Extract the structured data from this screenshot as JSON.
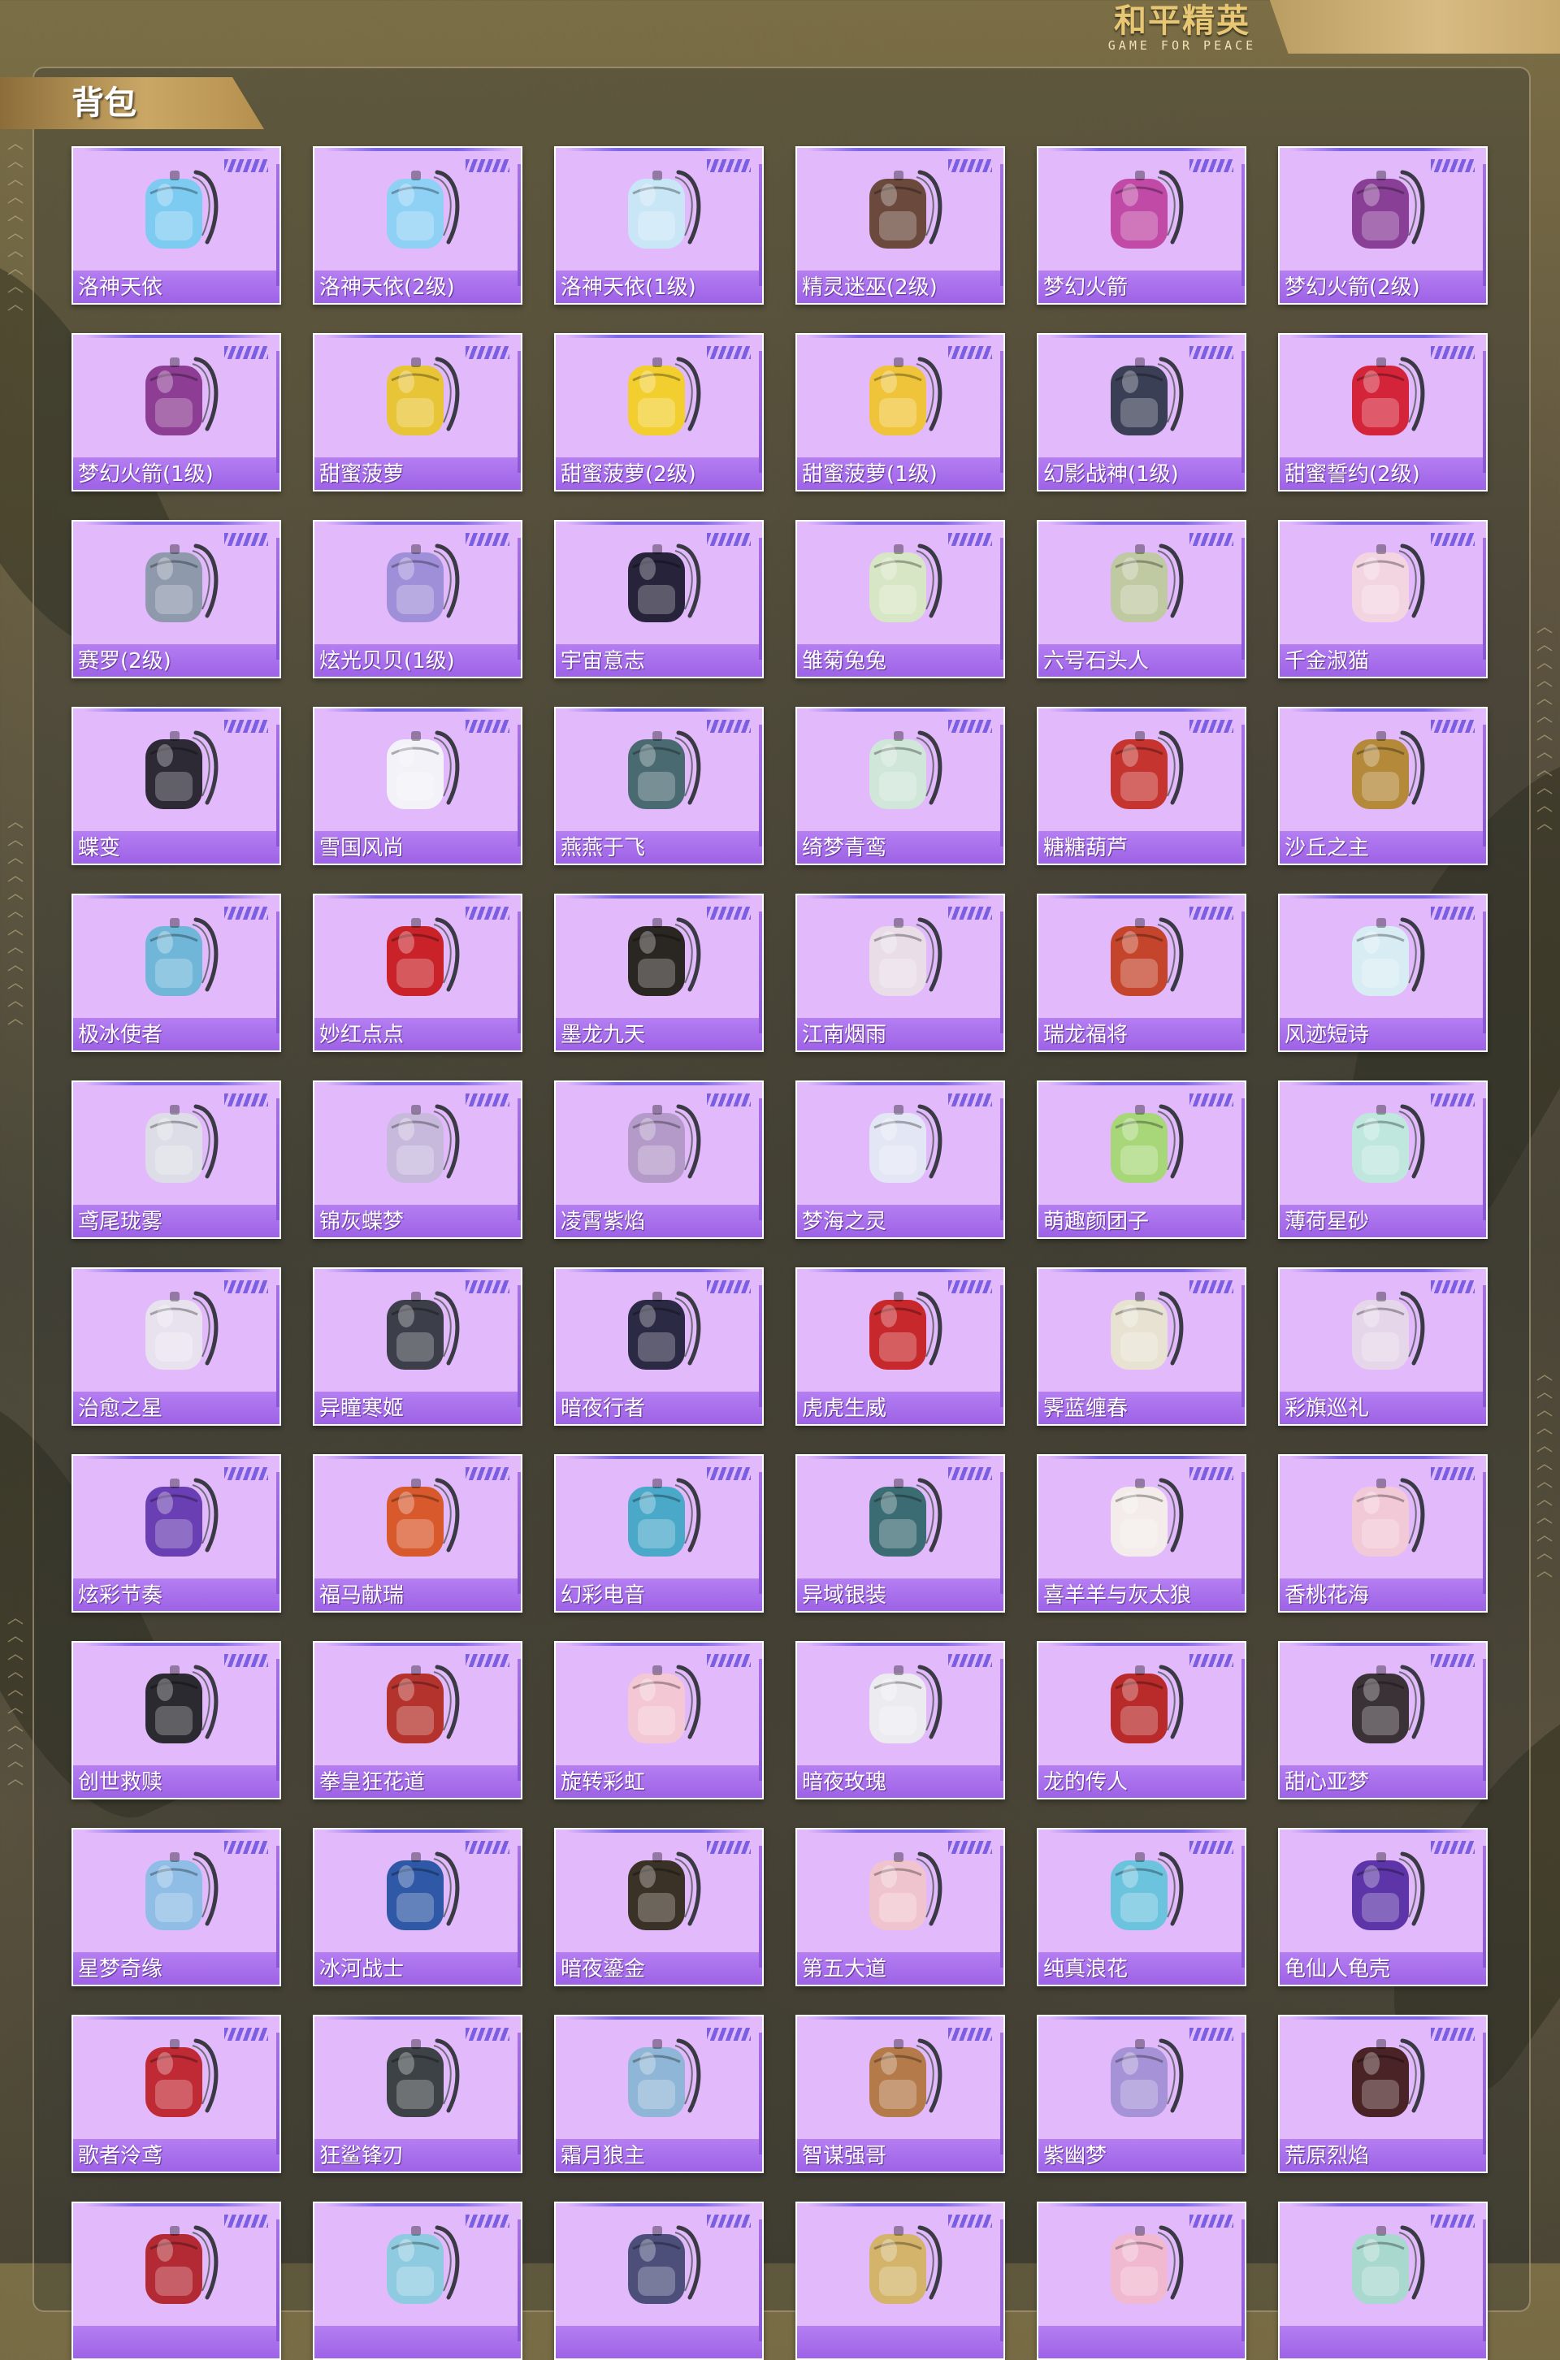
{
  "logo": {
    "main": "和平精英",
    "sub": "GAME FOR PEACE"
  },
  "section": {
    "title": "背包"
  },
  "items": [
    {
      "name": "洛神天依",
      "icon": "backpack-icon",
      "color": "#7ecbf2"
    },
    {
      "name": "洛神天依(2级)",
      "icon": "backpack-icon",
      "color": "#8fd0f5"
    },
    {
      "name": "洛神天依(1级)",
      "icon": "backpack-icon",
      "color": "#c9e6f7"
    },
    {
      "name": "精灵迷巫(2级)",
      "icon": "backpack-icon",
      "color": "#6b4a3d"
    },
    {
      "name": "梦幻火箭",
      "icon": "backpack-icon",
      "color": "#c04aa6"
    },
    {
      "name": "梦幻火箭(2级)",
      "icon": "backpack-icon",
      "color": "#8a3f97"
    },
    {
      "name": "梦幻火箭(1级)",
      "icon": "backpack-icon",
      "color": "#8d3d93"
    },
    {
      "name": "甜蜜菠萝",
      "icon": "backpack-icon",
      "color": "#e8c537"
    },
    {
      "name": "甜蜜菠萝(2级)",
      "icon": "backpack-icon",
      "color": "#f2cf2f"
    },
    {
      "name": "甜蜜菠萝(1级)",
      "icon": "backpack-icon",
      "color": "#f0c43a"
    },
    {
      "name": "幻影战神(1级)",
      "icon": "backpack-icon",
      "color": "#3b3f56"
    },
    {
      "name": "甜蜜誓约(2级)",
      "icon": "backpack-icon",
      "color": "#d4243a"
    },
    {
      "name": "赛罗(2级)",
      "icon": "backpack-icon",
      "color": "#8e99ac"
    },
    {
      "name": "炫光贝贝(1级)",
      "icon": "backpack-icon",
      "color": "#9f8fd9"
    },
    {
      "name": "宇宙意志",
      "icon": "backpack-icon",
      "color": "#26233a"
    },
    {
      "name": "雏菊兔兔",
      "icon": "backpack-icon",
      "color": "#d7e6c4"
    },
    {
      "name": "六号石头人",
      "icon": "backpack-icon",
      "color": "#bfc9a2"
    },
    {
      "name": "千金淑猫",
      "icon": "backpack-icon",
      "color": "#f3d5e2"
    },
    {
      "name": "蝶变",
      "icon": "backpack-icon",
      "color": "#2d2a35"
    },
    {
      "name": "雪国风尚",
      "icon": "backpack-icon",
      "color": "#f2f2f8"
    },
    {
      "name": "燕燕于飞",
      "icon": "backpack-icon",
      "color": "#4a6a72"
    },
    {
      "name": "绮梦青鸾",
      "icon": "backpack-icon",
      "color": "#cfe6d9"
    },
    {
      "name": "糖糖葫芦",
      "icon": "backpack-icon",
      "color": "#c6342f"
    },
    {
      "name": "沙丘之主",
      "icon": "backpack-icon",
      "color": "#b5893a"
    },
    {
      "name": "极冰使者",
      "icon": "backpack-icon",
      "color": "#6fb6d8"
    },
    {
      "name": "妙红点点",
      "icon": "backpack-icon",
      "color": "#c92229"
    },
    {
      "name": "墨龙九天",
      "icon": "backpack-icon",
      "color": "#2a2622"
    },
    {
      "name": "江南烟雨",
      "icon": "backpack-icon",
      "color": "#e9dde8"
    },
    {
      "name": "瑞龙福将",
      "icon": "backpack-icon",
      "color": "#c5452c"
    },
    {
      "name": "风迹短诗",
      "icon": "backpack-icon",
      "color": "#d7ecf3"
    },
    {
      "name": "鸢尾珑雾",
      "icon": "backpack-icon",
      "color": "#dcdde6"
    },
    {
      "name": "锦灰蝶梦",
      "icon": "backpack-icon",
      "color": "#c7b9dc"
    },
    {
      "name": "凌霄紫焰",
      "icon": "backpack-icon",
      "color": "#b49ac9"
    },
    {
      "name": "梦海之灵",
      "icon": "backpack-icon",
      "color": "#e3e6f4"
    },
    {
      "name": "萌趣颜团子",
      "icon": "backpack-icon",
      "color": "#a8d77a"
    },
    {
      "name": "薄荷星砂",
      "icon": "backpack-icon",
      "color": "#bfe7de"
    },
    {
      "name": "治愈之星",
      "icon": "backpack-icon",
      "color": "#e8e2ef"
    },
    {
      "name": "异瞳寒姬",
      "icon": "backpack-icon",
      "color": "#3c3f4a"
    },
    {
      "name": "暗夜行者",
      "icon": "backpack-icon",
      "color": "#2b2a45"
    },
    {
      "name": "虎虎生威",
      "icon": "backpack-icon",
      "color": "#c7282b"
    },
    {
      "name": "霁蓝缠春",
      "icon": "backpack-icon",
      "color": "#e7e2d2"
    },
    {
      "name": "彩旗巡礼",
      "icon": "backpack-icon",
      "color": "#e6d6ea"
    },
    {
      "name": "炫彩节奏",
      "icon": "backpack-icon",
      "color": "#6a3fb3"
    },
    {
      "name": "福马献瑞",
      "icon": "backpack-icon",
      "color": "#d8592c"
    },
    {
      "name": "幻彩电音",
      "icon": "backpack-icon",
      "color": "#4aa8c9"
    },
    {
      "name": "异域银装",
      "icon": "backpack-icon",
      "color": "#3c6c73"
    },
    {
      "name": "喜羊羊与灰太狼",
      "icon": "backpack-icon",
      "color": "#f3ecea"
    },
    {
      "name": "香桃花海",
      "icon": "backpack-icon",
      "color": "#f2c9d6"
    },
    {
      "name": "创世救赎",
      "icon": "backpack-icon",
      "color": "#2a2a30"
    },
    {
      "name": "拳皇狂花道",
      "icon": "backpack-icon",
      "color": "#b5332d"
    },
    {
      "name": "旋转彩虹",
      "icon": "backpack-icon",
      "color": "#f3c7d3"
    },
    {
      "name": "暗夜玫瑰",
      "icon": "backpack-icon",
      "color": "#ecebf0"
    },
    {
      "name": "龙的传人",
      "icon": "backpack-icon",
      "color": "#b92a2a"
    },
    {
      "name": "甜心亚梦",
      "icon": "backpack-icon",
      "color": "#3b3238"
    },
    {
      "name": "星梦奇缘",
      "icon": "backpack-icon",
      "color": "#8fbde6"
    },
    {
      "name": "冰河战士",
      "icon": "backpack-icon",
      "color": "#2f58a6"
    },
    {
      "name": "暗夜鎏金",
      "icon": "backpack-icon",
      "color": "#3a3226"
    },
    {
      "name": "第五大道",
      "icon": "backpack-icon",
      "color": "#f0c4cf"
    },
    {
      "name": "纯真浪花",
      "icon": "backpack-icon",
      "color": "#6cc3de"
    },
    {
      "name": "龟仙人龟壳",
      "icon": "backpack-icon",
      "color": "#5d35a8"
    },
    {
      "name": "歌者泠鸢",
      "icon": "backpack-icon",
      "color": "#c02a34"
    },
    {
      "name": "狂鲨锋刃",
      "icon": "backpack-icon",
      "color": "#3c4246"
    },
    {
      "name": "霜月狼主",
      "icon": "backpack-icon",
      "color": "#8fb6d6"
    },
    {
      "name": "智谋强哥",
      "icon": "backpack-icon",
      "color": "#b47a4a"
    },
    {
      "name": "紫幽梦",
      "icon": "backpack-icon",
      "color": "#a692d6"
    },
    {
      "name": "荒原烈焰",
      "icon": "backpack-icon",
      "color": "#4a2326"
    },
    {
      "name": "",
      "icon": "backpack-icon",
      "color": "#b32a34"
    },
    {
      "name": "",
      "icon": "backpack-icon",
      "color": "#8fcbe0"
    },
    {
      "name": "",
      "icon": "backpack-icon",
      "color": "#4b4f7a"
    },
    {
      "name": "",
      "icon": "backpack-icon",
      "color": "#d3b46a"
    },
    {
      "name": "",
      "icon": "backpack-icon",
      "color": "#f0b9cf"
    },
    {
      "name": "",
      "icon": "backpack-icon",
      "color": "#a9d8cf"
    }
  ]
}
